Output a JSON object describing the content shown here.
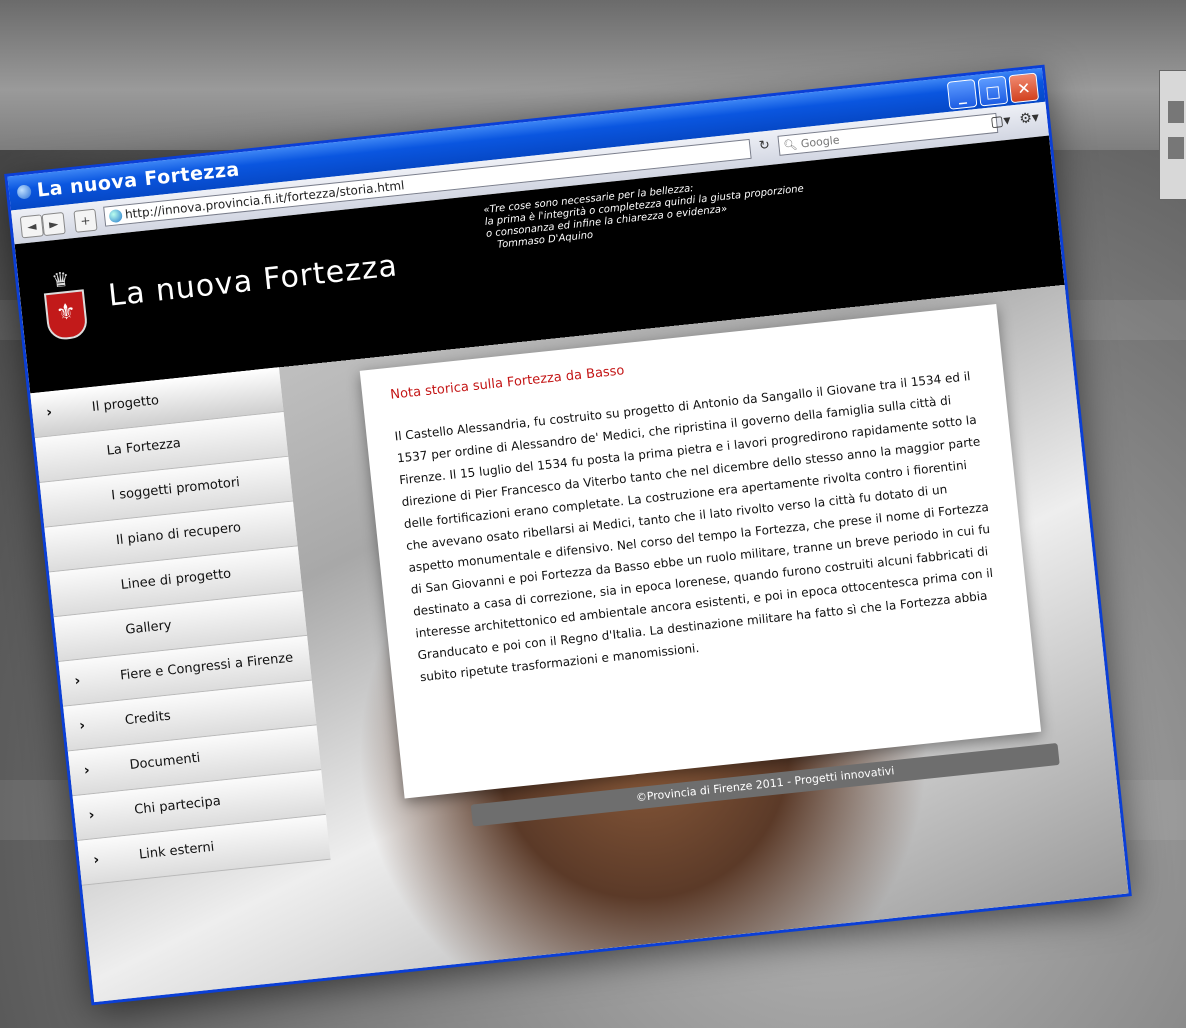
{
  "window": {
    "title": "La nuova Fortezza",
    "min": "_",
    "max": "□",
    "close": "✕"
  },
  "toolbar": {
    "back": "◄",
    "forward": "►",
    "add": "+",
    "url": "http://innova.provincia.fi.it/fortezza/storia.html",
    "reload": "↻",
    "search_placeholder": "Google",
    "page_menu": "▢▾",
    "tools_menu": "⚙▾"
  },
  "site": {
    "title": "La nuova Fortezza",
    "quote_lines": [
      "«Tre cose sono necessarie per la bellezza:",
      "la prima è l'integrità o completezza quindi la giusta proporzione",
      "o consonanza ed infine la chiarezza o evidenza»"
    ],
    "quote_author": "Tommaso D'Aquino"
  },
  "nav": [
    {
      "label": "Il progetto",
      "arrow": "›",
      "sub": false
    },
    {
      "label": "La Fortezza",
      "arrow": "",
      "sub": true
    },
    {
      "label": "I soggetti promotori",
      "arrow": "",
      "sub": true
    },
    {
      "label": "Il piano di recupero",
      "arrow": "",
      "sub": true
    },
    {
      "label": "Linee di progetto",
      "arrow": "",
      "sub": true
    },
    {
      "label": "Gallery",
      "arrow": "",
      "sub": true
    },
    {
      "label": "Fiere e Congressi a Firenze",
      "arrow": "›",
      "sub": false
    },
    {
      "label": "Credits",
      "arrow": "›",
      "sub": false
    },
    {
      "label": "Documenti",
      "arrow": "›",
      "sub": false
    },
    {
      "label": "Chi partecipa",
      "arrow": "›",
      "sub": false
    },
    {
      "label": "Link esterni",
      "arrow": "›",
      "sub": false
    }
  ],
  "content": {
    "heading": "Nota storica sulla Fortezza da Basso",
    "text": "Il Castello Alessandria, fu costruito su progetto di Antonio da Sangallo il Giovane tra il 1534 ed il 1537 per ordine di Alessandro de' Medici, che ripristina il governo della famiglia sulla città di Firenze. Il 15 luglio del 1534 fu posta la prima pietra e i lavori progredirono rapidamente sotto la direzione di Pier Francesco da Viterbo tanto che nel dicembre dello stesso anno la maggior parte delle fortificazioni erano completate. La costruzione era apertamente rivolta contro i fiorentini che avevano osato ribellarsi ai Medici, tanto che il lato rivolto verso la città fu dotato di un aspetto monumentale e difensivo. Nel corso del tempo la Fortezza, che prese il nome di Fortezza di San Giovanni e poi Fortezza da Basso ebbe un ruolo militare, tranne un breve periodo in cui fu destinato a casa di correzione, sia in epoca lorenese, quando furono costruiti alcuni fabbricati di interesse architettonico ed ambientale ancora esistenti, e poi in epoca ottocentesca prima con il Granducato e poi con il Regno d'Italia. La destinazione militare ha fatto sì che la Fortezza abbia subito ripetute trasformazioni e manomissioni."
  },
  "footer": "©Provincia di Firenze 2011 - Progetti innovativi",
  "colors": {
    "xp_blue": "#0a56e0",
    "heading_red": "#c41616",
    "header_black": "#000000"
  }
}
